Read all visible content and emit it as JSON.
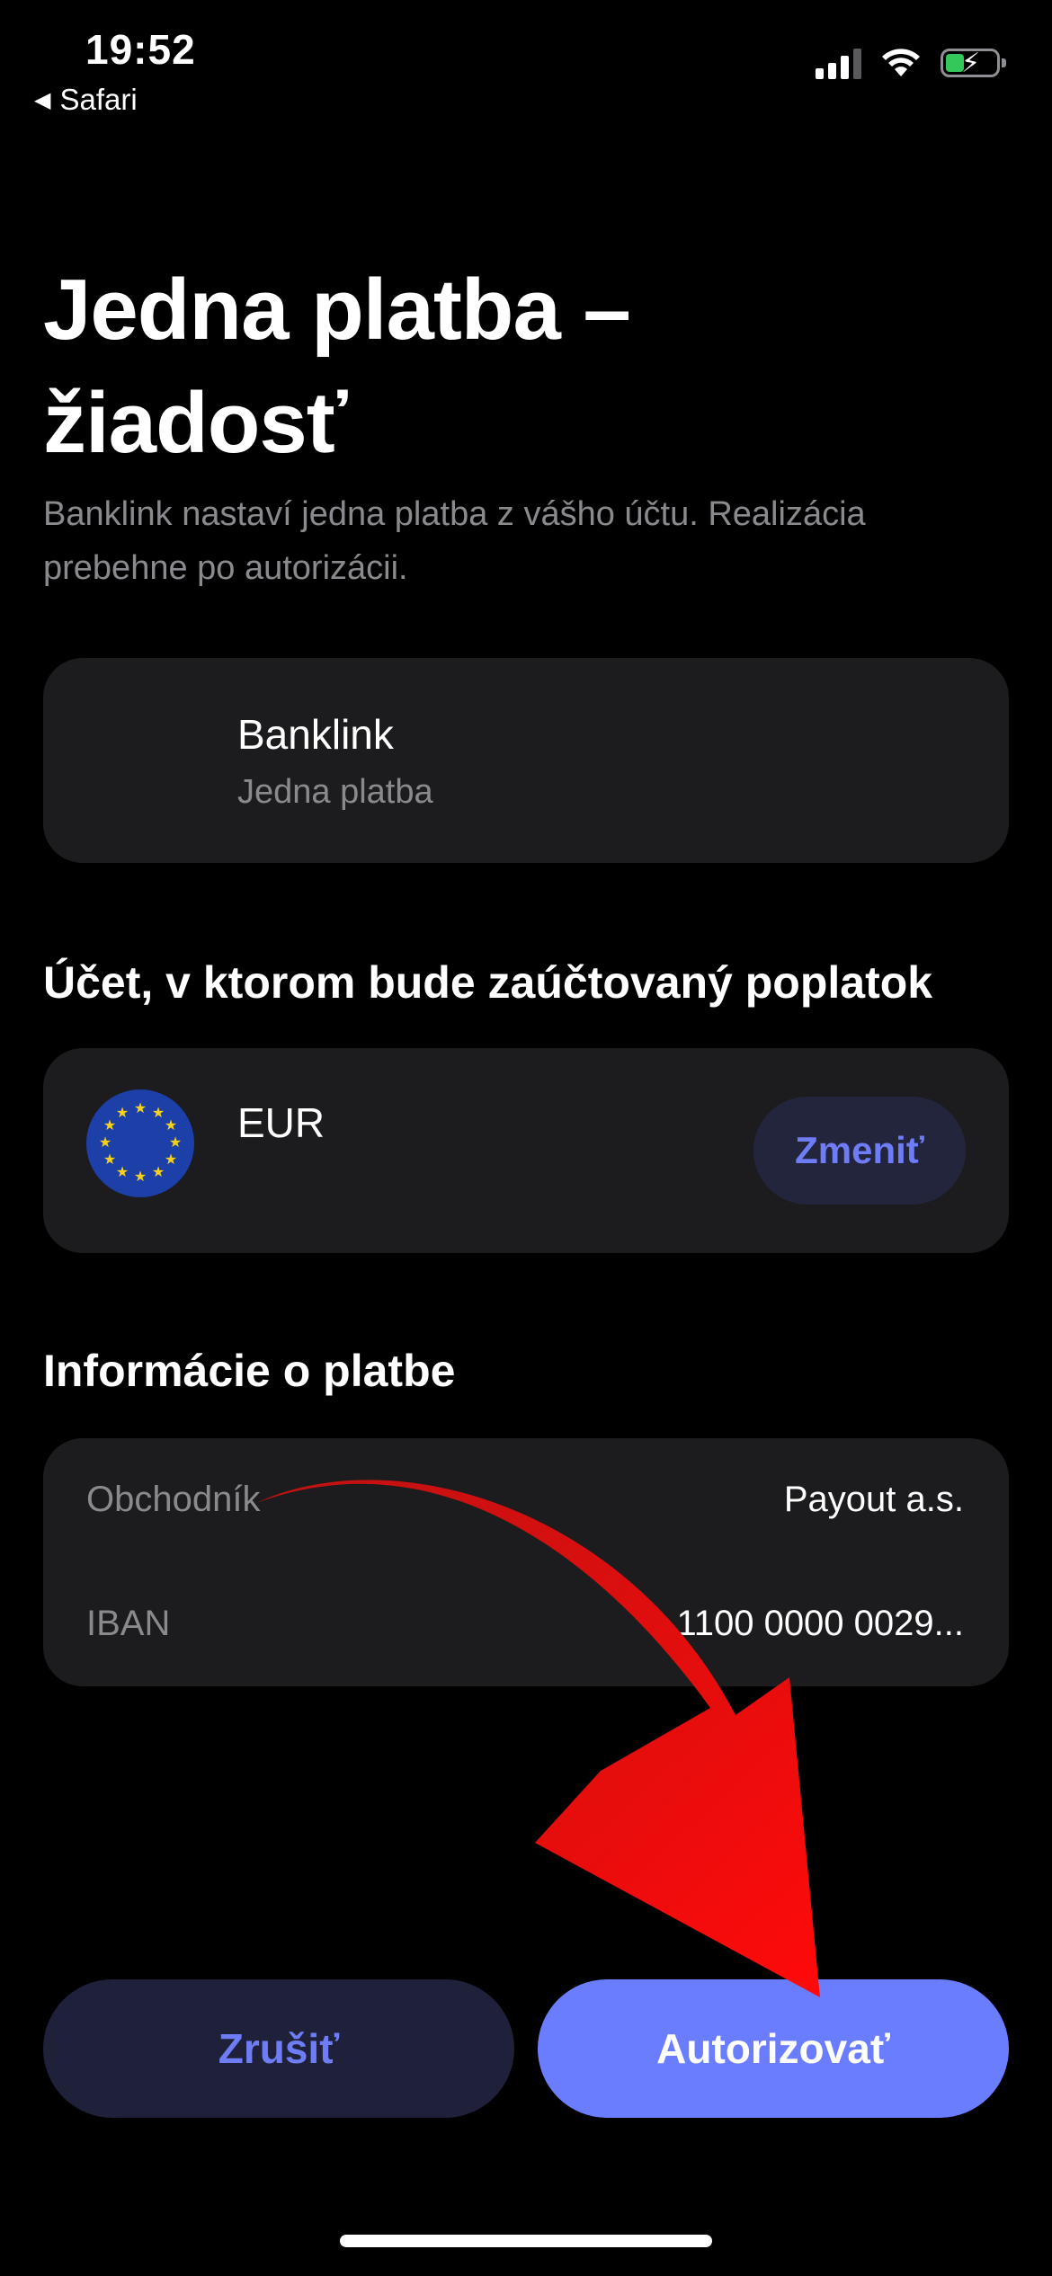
{
  "status_bar": {
    "time": "19:52",
    "back_app": "Safari",
    "icons": [
      "signal-icon",
      "wifi-icon",
      "battery-charging-icon"
    ]
  },
  "header": {
    "title_line1": "Jedna platba –",
    "title_line2": "žiadosť",
    "subtitle_line1": "Banklink nastaví jedna platba z vášho účtu. Realizácia",
    "subtitle_line2": "prebehne po autorizácii."
  },
  "merchant_card": {
    "name": "Banklink",
    "type": "Jedna platba"
  },
  "account_section": {
    "title": "Účet, v ktorom bude zaúčtovaný poplatok",
    "currency": "EUR",
    "change_label": "Zmeniť"
  },
  "payment_section": {
    "title": "Informácie o platbe",
    "rows": [
      {
        "label": "Obchodník",
        "value": "Payout a.s."
      },
      {
        "label": "IBAN",
        "value": "1100 0000 0029..."
      }
    ]
  },
  "actions": {
    "cancel_label": "Zrušiť",
    "authorize_label": "Autorizovať"
  },
  "colors": {
    "accent": "#6b7dff",
    "card_bg": "#1c1c1e",
    "annotation_arrow": "#e01010"
  }
}
